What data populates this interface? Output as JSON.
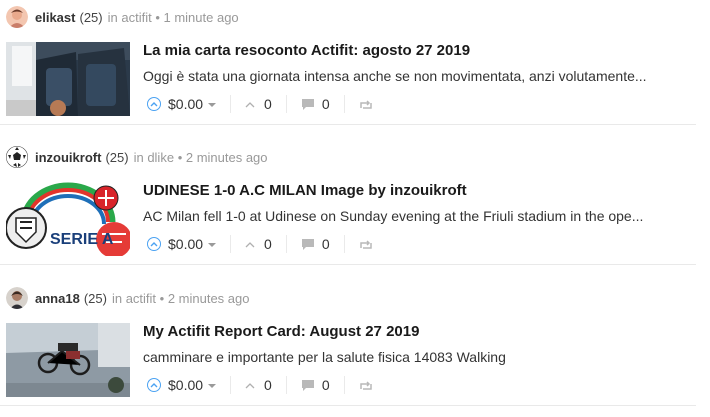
{
  "posts": [
    {
      "author": "elikast",
      "reputation": "(25)",
      "in_label": "in",
      "category": "actifit",
      "time": "• 1 minute ago",
      "title": "La mia carta resoconto Actifit: agosto 27 2019",
      "excerpt": "Oggi è stata una giornata intensa anche se non movimentata, anzi volutamente...",
      "payout": "$0.00",
      "votes": "0",
      "comments": "0"
    },
    {
      "author": "inzouikroft",
      "reputation": "(25)",
      "in_label": "in",
      "category": "dlike",
      "time": "• 2 minutes ago",
      "title": "UDINESE 1-0 A.C MILAN Image by inzouikroft",
      "excerpt": "AC Milan fell 1-0 at Udinese on Sunday evening at the Friuli stadium in the ope...",
      "payout": "$0.00",
      "votes": "0",
      "comments": "0",
      "thumb_text": "SERIE A"
    },
    {
      "author": "anna18",
      "reputation": "(25)",
      "in_label": "in",
      "category": "actifit",
      "time": "• 2 minutes ago",
      "title": "My Actifit Report Card: August 27 2019",
      "excerpt": "camminare e importante per la salute fisica 14083 Walking",
      "payout": "$0.00",
      "votes": "0",
      "comments": "0"
    }
  ],
  "colors": {
    "upvote_accent": "#4ba2f2",
    "muted": "#999999",
    "divider": "#e9e9e9"
  },
  "icons": [
    "upvote-icon",
    "chevron-up-icon",
    "comment-icon",
    "reblog-icon",
    "dropdown-caret-icon"
  ]
}
